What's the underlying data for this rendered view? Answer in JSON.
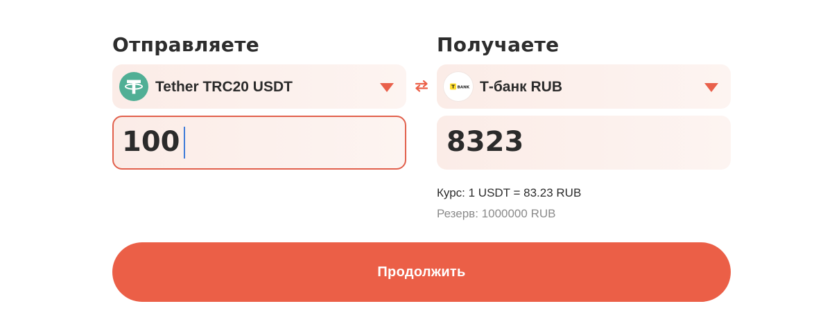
{
  "send": {
    "heading": "Отправляете",
    "currency": {
      "label": "Tether TRC20 USDT",
      "icon": "tether-icon",
      "icon_color": "#50af95"
    },
    "amount": "100"
  },
  "receive": {
    "heading": "Получаете",
    "currency": {
      "label": "Т-банк RUB",
      "icon": "tbank-icon",
      "icon_text": "BANK",
      "icon_color": "#ffdd2d"
    },
    "amount": "8323",
    "rate": "Курс: 1 USDT = 83.23 RUB",
    "reserve": "Резерв: 1000000 RUB"
  },
  "swap_icon": "swap-arrows-icon",
  "continue_label": "Продолжить",
  "colors": {
    "accent": "#eb5f47",
    "field_bg": "#fbece7",
    "caret": "#3d7bd9"
  }
}
